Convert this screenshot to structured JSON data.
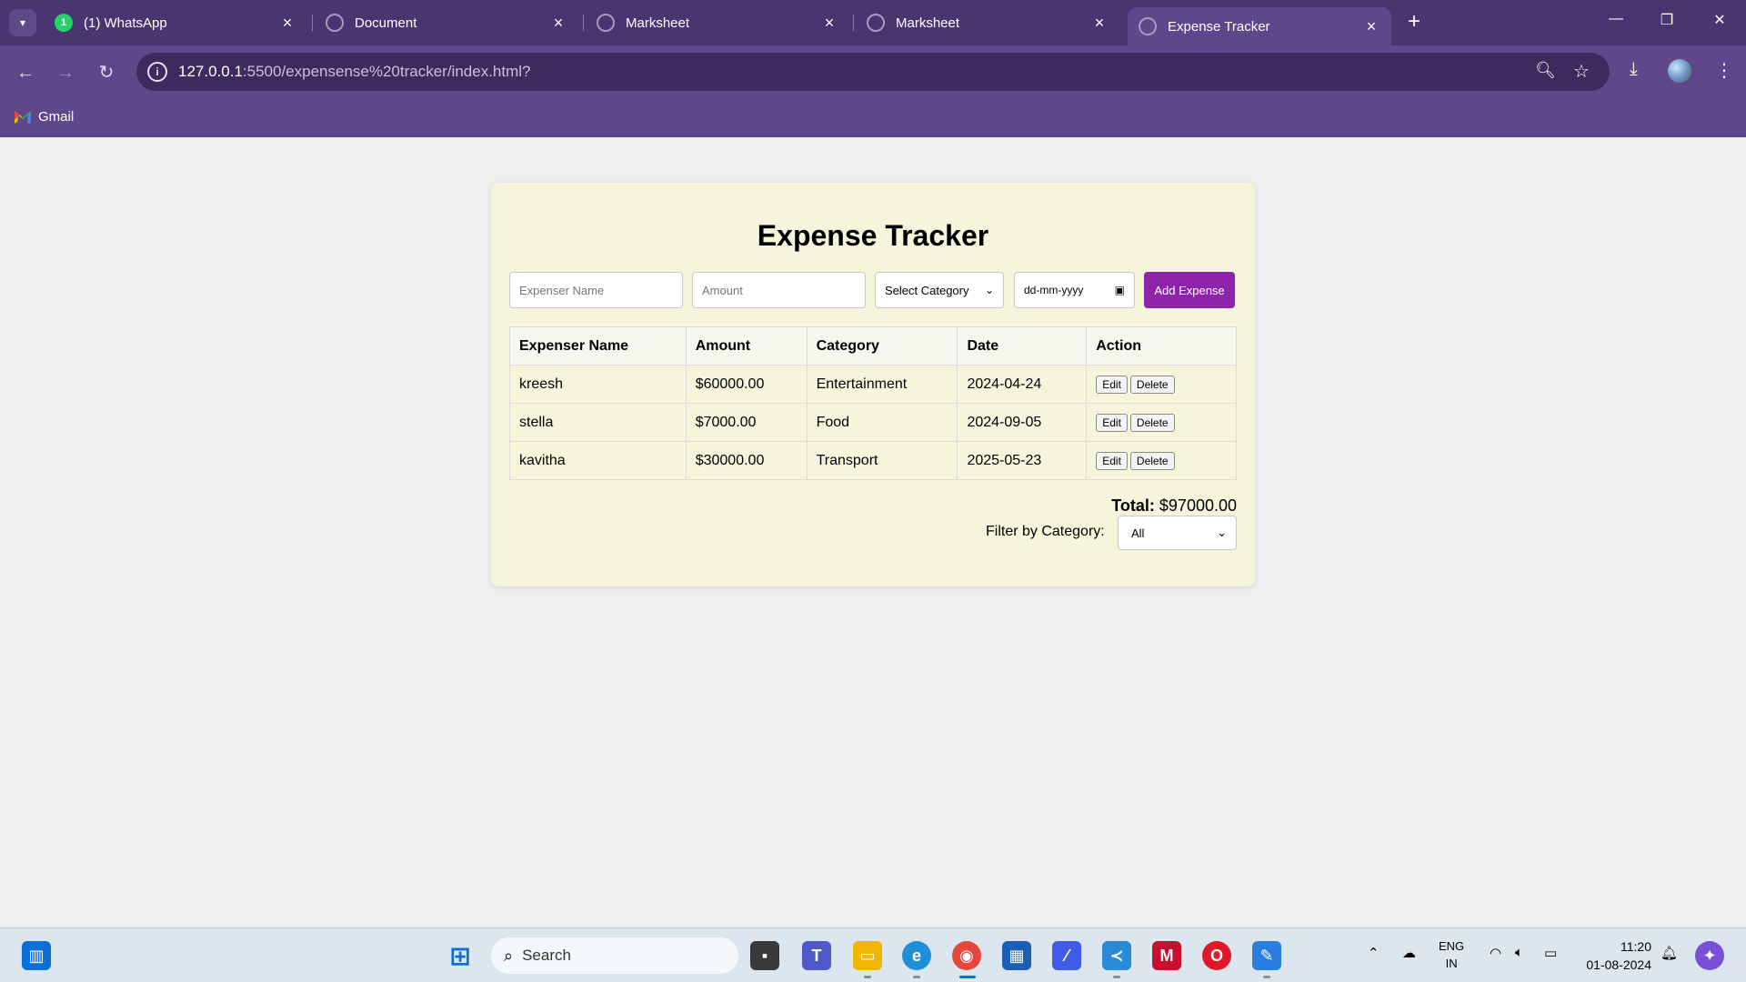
{
  "browser": {
    "tabs": [
      {
        "title": "(1) WhatsApp",
        "favicon": "whatsapp-icon",
        "badge": "1"
      },
      {
        "title": "Document",
        "favicon": "globe-icon"
      },
      {
        "title": "Marksheet",
        "favicon": "globe-icon"
      },
      {
        "title": "Marksheet",
        "favicon": "globe-icon"
      },
      {
        "title": "Expense Tracker",
        "favicon": "globe-icon",
        "active": true
      }
    ],
    "url_host": "127.0.0.1",
    "url_path": ":5500/expensense%20tracker/index.html?",
    "bookmark": "Gmail",
    "accent_color": "#5e478b"
  },
  "app": {
    "title": "Expense Tracker",
    "name_placeholder": "Expenser Name",
    "amount_placeholder": "Amount",
    "category_select": "Select Category",
    "date_placeholder": "dd-mm-yyyy",
    "add_button": "Add Expense",
    "button_color": "#8e24aa",
    "table": {
      "headers": [
        "Expenser Name",
        "Amount",
        "Category",
        "Date",
        "Action"
      ],
      "rows": [
        {
          "name": "kreesh",
          "amount": "$60000.00",
          "category": "Entertainment",
          "date": "2024-04-24"
        },
        {
          "name": "stella",
          "amount": "$7000.00",
          "category": "Food",
          "date": "2024-09-05"
        },
        {
          "name": "kavitha",
          "amount": "$30000.00",
          "category": "Transport",
          "date": "2025-05-23"
        }
      ],
      "edit_label": "Edit",
      "delete_label": "Delete"
    },
    "total_label": "Total:",
    "total_value": "$97000.00",
    "filter_label": "Filter by Category:",
    "filter_value": "All"
  },
  "taskbar": {
    "search_placeholder": "Search",
    "lang_top": "ENG",
    "lang_bottom": "IN",
    "time": "11:20",
    "date": "01-08-2024"
  }
}
